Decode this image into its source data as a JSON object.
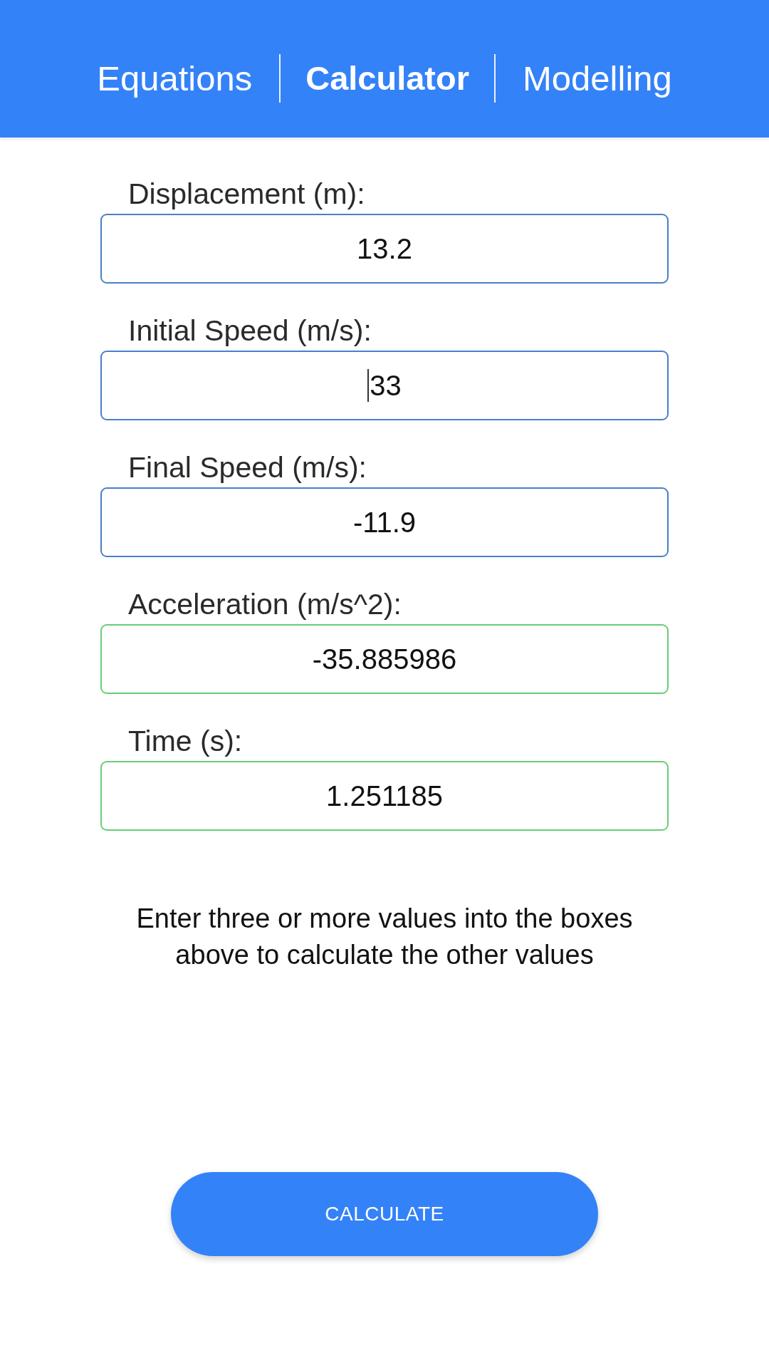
{
  "tabs": [
    {
      "label": "Equations",
      "selected": false
    },
    {
      "label": "Calculator",
      "selected": true
    },
    {
      "label": "Modelling",
      "selected": false
    }
  ],
  "fields": [
    {
      "label": "Displacement (m):",
      "value": "13.2",
      "calculated": false,
      "focused": false
    },
    {
      "label": "Initial Speed (m/s):",
      "value": "33",
      "calculated": false,
      "focused": true
    },
    {
      "label": "Final Speed (m/s):",
      "value": "-11.9",
      "calculated": false,
      "focused": false
    },
    {
      "label": "Acceleration (m/s^2):",
      "value": "-35.885986",
      "calculated": true,
      "focused": false
    },
    {
      "label": "Time (s):",
      "value": "1.251185",
      "calculated": true,
      "focused": false
    }
  ],
  "hint": "Enter three or more values into the boxes above to calculate the other values",
  "button": "CALCULATE"
}
